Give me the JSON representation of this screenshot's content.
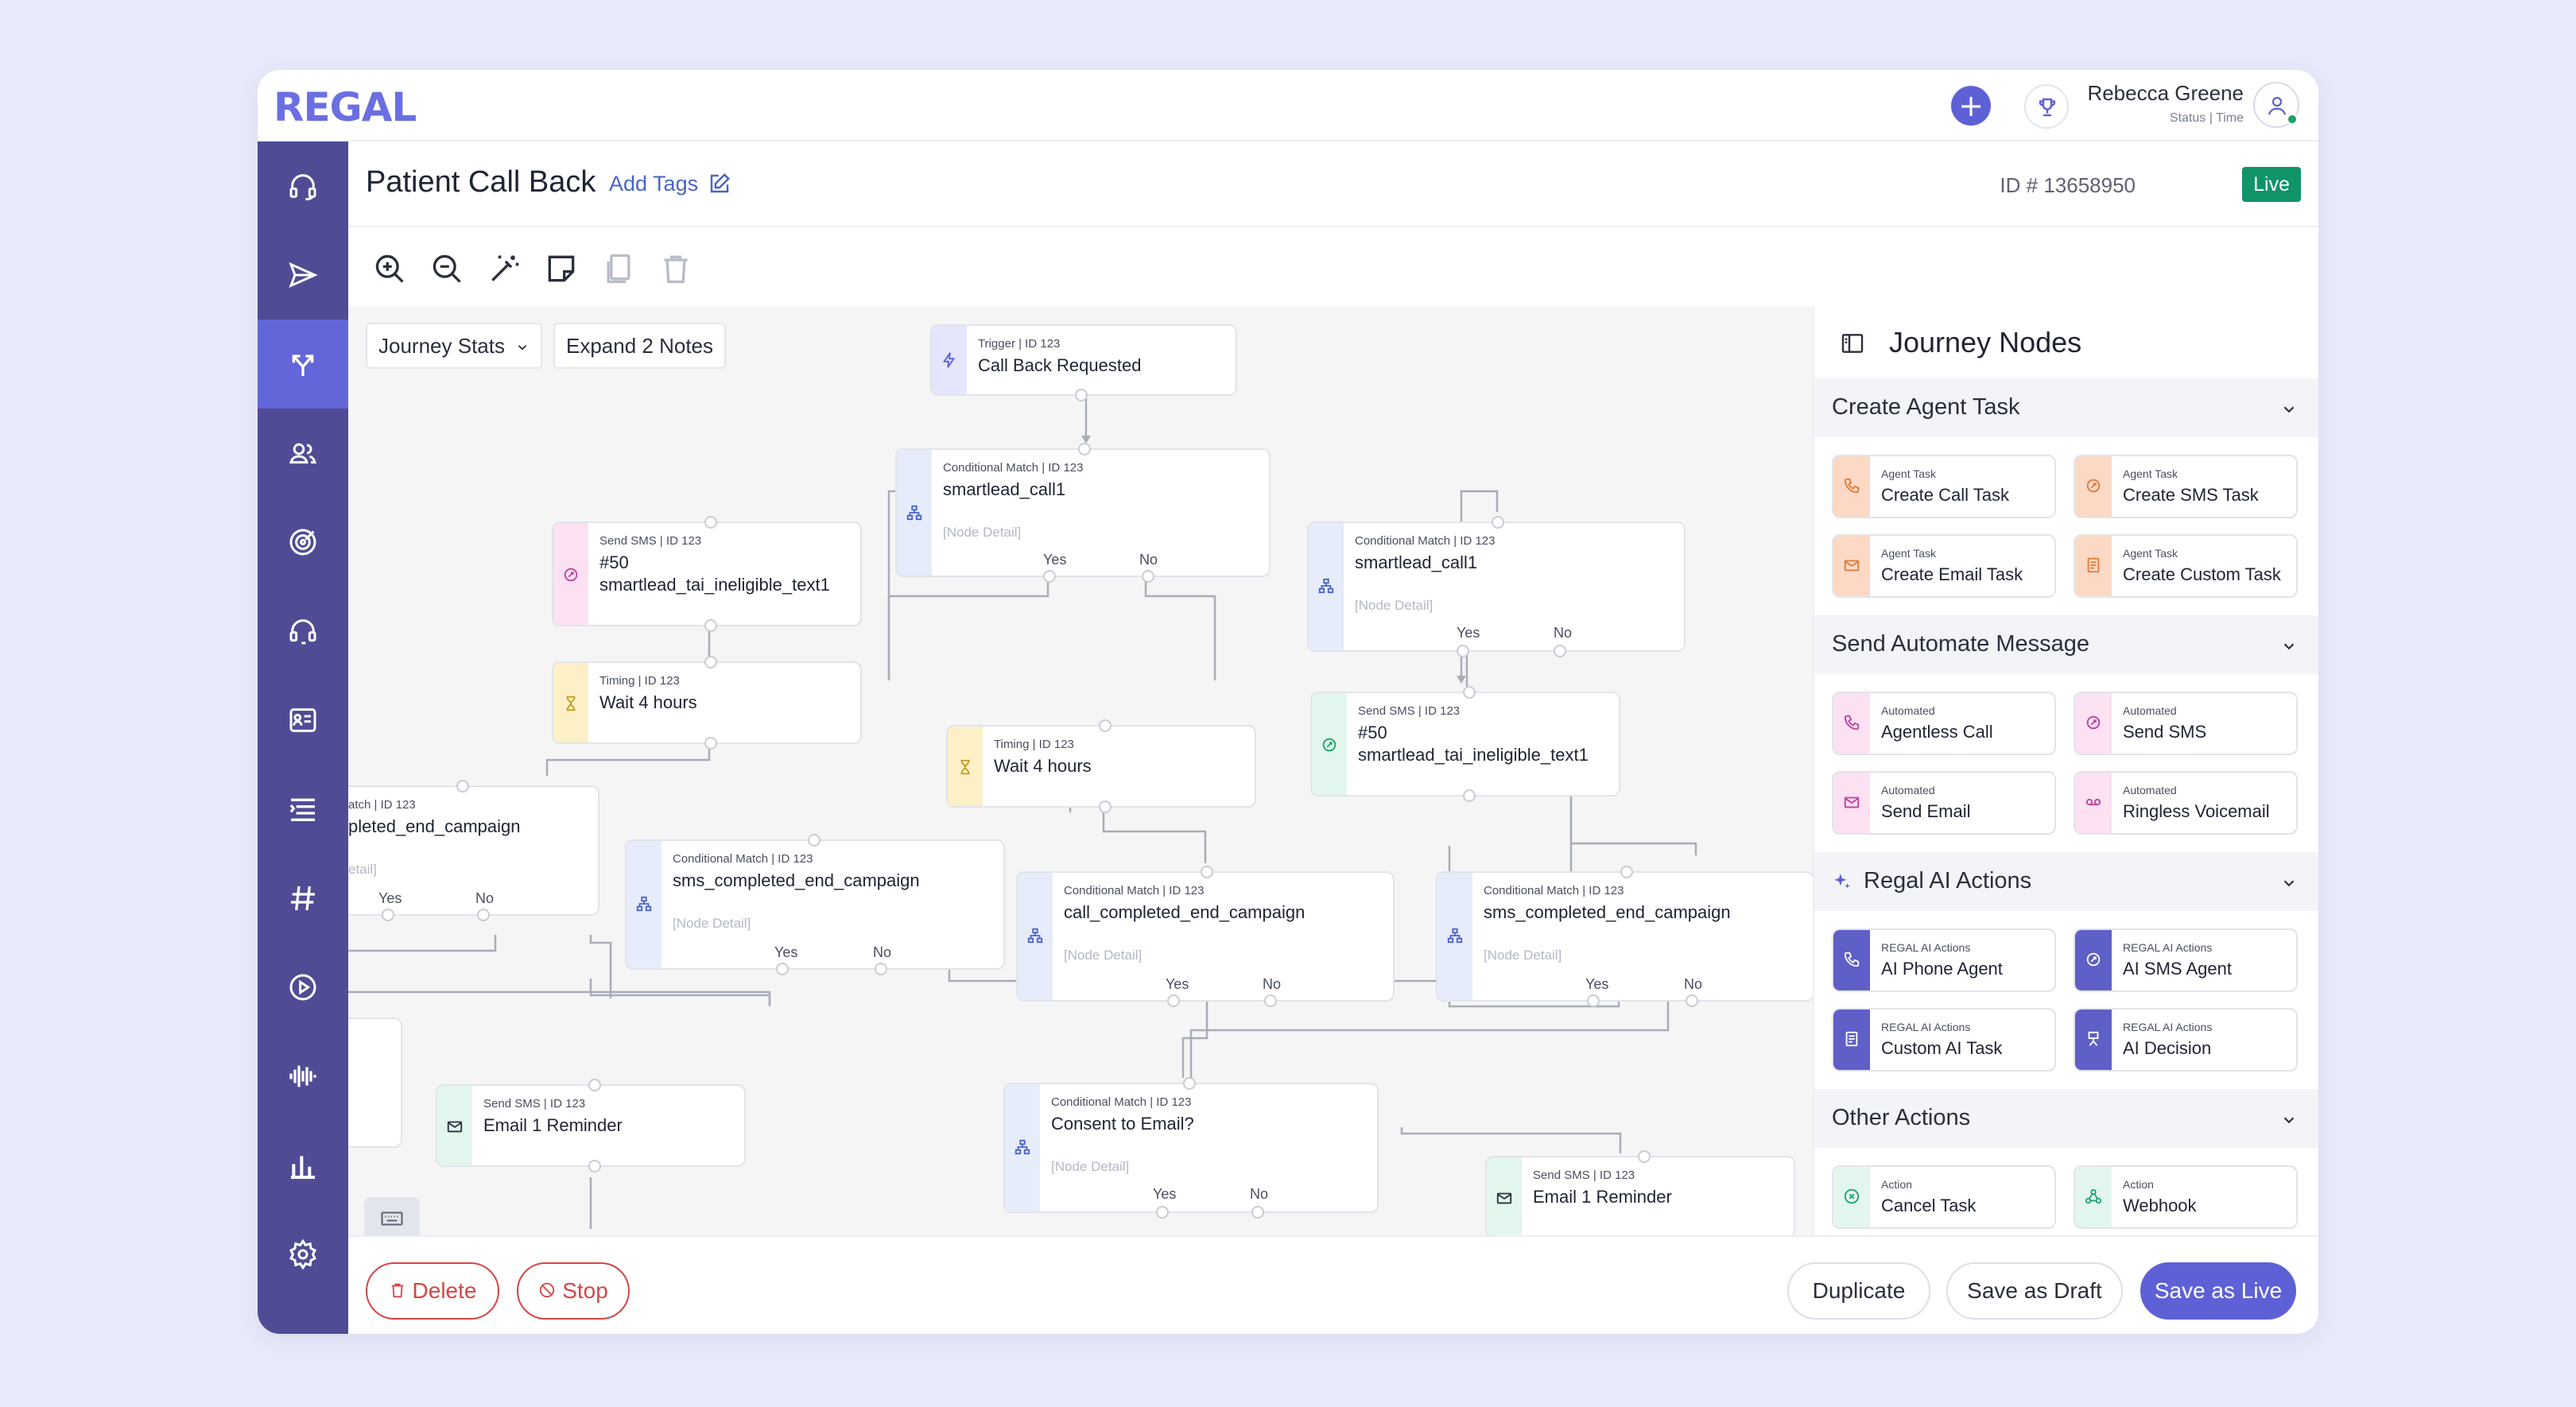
{
  "app": {
    "logo": "REGAL"
  },
  "user": {
    "name": "Rebecca Greene",
    "status": "Status | Time"
  },
  "sidebar": {
    "items": [
      {
        "icon": "headset-icon"
      },
      {
        "icon": "send-icon"
      },
      {
        "icon": "journeys-icon",
        "active": true
      },
      {
        "icon": "contacts-icon"
      },
      {
        "icon": "target-icon"
      },
      {
        "icon": "agent-headset-icon"
      },
      {
        "icon": "profile-card-icon"
      },
      {
        "icon": "list-icon"
      },
      {
        "icon": "hashtag-icon"
      },
      {
        "icon": "play-icon"
      },
      {
        "icon": "waveform-icon"
      },
      {
        "icon": "bar-chart-icon"
      },
      {
        "icon": "settings-icon"
      }
    ]
  },
  "header": {
    "title": "Patient Call Back",
    "add_tags": "Add Tags",
    "id_label": "ID # 13658950",
    "status_badge": "Live"
  },
  "canvas": {
    "journey_stats": "Journey Stats",
    "expand_notes": "Expand 2 Notes",
    "nodes": {
      "trigger": {
        "meta": "Trigger | ID 123",
        "title": "Call Back Requested"
      },
      "cm1": {
        "meta": "Conditional Match | ID 123",
        "title": "smartlead_call1",
        "detail": "[Node Detail]",
        "yes": "Yes",
        "no": "No"
      },
      "sms1": {
        "meta": "Send SMS | ID 123",
        "title1": "#50",
        "title2": "smartlead_tai_ineligible_text1"
      },
      "cm2": {
        "meta": "Conditional Match | ID 123",
        "title": "smartlead_call1",
        "detail": "[Node Detail]",
        "yes": "Yes",
        "no": "No"
      },
      "timing1": {
        "meta": "Timing | ID 123",
        "title": "Wait 4 hours"
      },
      "sms2": {
        "meta": "Send SMS | ID 123",
        "title1": "#50",
        "title2": "smartlead_tai_ineligible_text1"
      },
      "timing2": {
        "meta": "Timing | ID 123",
        "title": "Wait 4 hours"
      },
      "cm_left": {
        "meta": "atch | ID 123",
        "title": "pleted_end_campaign",
        "detail": "etail]",
        "yes": "Yes",
        "no": "No"
      },
      "cm3": {
        "meta": "Conditional Match | ID 123",
        "title": "sms_completed_end_campaign",
        "detail": "[Node Detail]",
        "yes": "Yes",
        "no": "No"
      },
      "cm4": {
        "meta": "Conditional Match | ID 123",
        "title": "call_completed_end_campaign",
        "detail": "[Node Detail]",
        "yes": "Yes",
        "no": "No"
      },
      "cm5": {
        "meta": "Conditional Match | ID 123",
        "title": "sms_completed_end_campaign",
        "detail": "[Node Detail]",
        "yes": "Yes",
        "no": "No"
      },
      "email1": {
        "meta": "Send SMS | ID 123",
        "title": "Email 1 Reminder"
      },
      "cm6": {
        "meta": "Conditional Match | ID 123",
        "title": "Consent to Email?",
        "detail": "[Node Detail]",
        "yes": "Yes",
        "no": "No"
      },
      "email2": {
        "meta": "Send SMS | ID 123",
        "title": "Email 1 Reminder"
      }
    }
  },
  "panel": {
    "title": "Journey Nodes",
    "sections": [
      {
        "label": "Create Agent Task",
        "cards": [
          {
            "cat": "Agent Task",
            "name": "Create Call Task",
            "icon": "phone-icon",
            "color": "#fbd9c4",
            "fg": "#e07a3a"
          },
          {
            "cat": "Agent Task",
            "name": "Create SMS Task",
            "icon": "sms-icon",
            "color": "#fbd9c4",
            "fg": "#e07a3a"
          },
          {
            "cat": "Agent Task",
            "name": "Create Email Task",
            "icon": "mail-icon",
            "color": "#fbd9c4",
            "fg": "#e07a3a"
          },
          {
            "cat": "Agent Task",
            "name": "Create Custom Task",
            "icon": "custom-task-icon",
            "color": "#fbd9c4",
            "fg": "#e07a3a"
          }
        ]
      },
      {
        "label": "Send Automate Message",
        "cards": [
          {
            "cat": "Automated",
            "name": "Agentless Call",
            "icon": "phone-icon",
            "color": "#fbe1f2",
            "fg": "#c040a0"
          },
          {
            "cat": "Automated",
            "name": "Send SMS",
            "icon": "sms-icon",
            "color": "#fbe1f2",
            "fg": "#c040a0"
          },
          {
            "cat": "Automated",
            "name": "Send Email",
            "icon": "mail-icon",
            "color": "#fbe1f2",
            "fg": "#c040a0"
          },
          {
            "cat": "Automated",
            "name": "Ringless Voicemail",
            "icon": "voicemail-icon",
            "color": "#fbe1f2",
            "fg": "#c040a0"
          }
        ]
      },
      {
        "label": "Regal AI Actions",
        "cards": [
          {
            "cat": "REGAL AI Actions",
            "name": "AI Phone Agent",
            "icon": "phone-icon",
            "color": "#5e5fc7",
            "fg": "#ffffff"
          },
          {
            "cat": "REGAL AI Actions",
            "name": "AI SMS Agent",
            "icon": "sms-icon",
            "color": "#5e5fc7",
            "fg": "#ffffff"
          },
          {
            "cat": "REGAL AI Actions",
            "name": "Custom AI Task",
            "icon": "custom-task-icon",
            "color": "#5e5fc7",
            "fg": "#ffffff"
          },
          {
            "cat": "REGAL AI Actions",
            "name": "AI Decision",
            "icon": "decision-icon",
            "color": "#5e5fc7",
            "fg": "#ffffff"
          }
        ]
      },
      {
        "label": "Other Actions",
        "cards": [
          {
            "cat": "Action",
            "name": "Cancel Task",
            "icon": "cancel-icon",
            "color": "#e3f6ee",
            "fg": "#1aa36b"
          },
          {
            "cat": "Action",
            "name": "Webhook",
            "icon": "webhook-icon",
            "color": "#e3f6ee",
            "fg": "#1aa36b"
          }
        ]
      }
    ]
  },
  "footer": {
    "delete": "Delete",
    "stop": "Stop",
    "duplicate": "Duplicate",
    "save_draft": "Save as Draft",
    "save_live": "Save as Live"
  },
  "colors": {
    "brand": "#6b6fe2",
    "sidebar": "#4f4c95",
    "sidebar_active": "#6266d8",
    "live": "#10946a",
    "danger": "#d64545",
    "primary": "#5e61d6"
  }
}
